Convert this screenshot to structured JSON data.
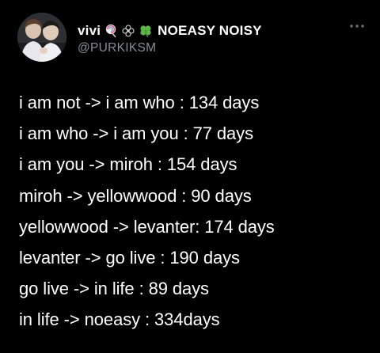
{
  "user": {
    "display_name": "vivi",
    "display_name_suffix": "NOEASY NOISY",
    "handle": "@PURKIKSM",
    "emojis": [
      "lollipop-icon",
      "flower-outline-icon",
      "four-leaf-clover-icon"
    ]
  },
  "tweet": {
    "lines": [
      "i am not -> i am who : 134 days",
      "i am who -> i am you : 77 days",
      "i am you -> miroh : 154 days",
      "miroh -> yellowwood : 90 days",
      "yellowwood -> levanter: 174 days",
      "levanter -> go live : 190 days",
      "go live -> in life : 89 days",
      "in life -> noeasy : 334days"
    ]
  },
  "colors": {
    "background": "#000000",
    "text": "#ffffff",
    "secondary_text": "#8a8d91"
  }
}
